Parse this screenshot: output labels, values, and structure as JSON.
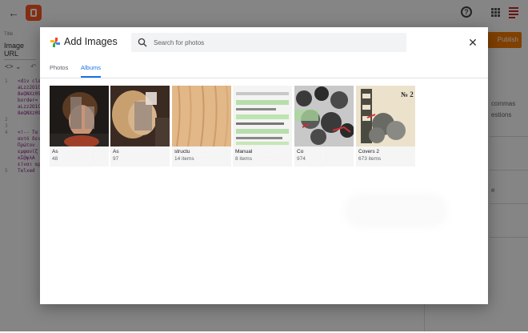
{
  "editor": {
    "title_label": "Title",
    "title_value": "Image URL",
    "publish_label": "Publish",
    "side_text_1": "commas",
    "side_text_2": "estions",
    "side_text_3": "e",
    "code_lines": "<div cla\naLzz2O1C\n8eQNXz09\nborder=\naLzz2O1C\n8eQNXz09\n\n\n<!-- Τα\nαυτό δεν\nΠρώτον\nεμφανίζ\nκΣ@ψλΑ\nείναι αρ\nTelxed",
    "line_numbers": "1 \n\n\n\n\n\n2\n3\n4 \n\n\n\n\n\n5",
    "accent": "#f57c00"
  },
  "dialog": {
    "title": "Add Images",
    "search_placeholder": "Search for photos",
    "close_label": "✕",
    "tabs": [
      {
        "label": "Photos",
        "active": false
      },
      {
        "label": "Albums",
        "active": true
      }
    ],
    "albums": [
      {
        "name": "As",
        "count": "48"
      },
      {
        "name": "As",
        "count": "97"
      },
      {
        "name": "structu",
        "count": "14 items"
      },
      {
        "name": "Manual",
        "count": "8 items"
      },
      {
        "name": "Co",
        "count": "974"
      },
      {
        "name": "Covers 2",
        "count": "673 items"
      }
    ],
    "cover_no_text": "№ 2",
    "link_color": "#1a73e8"
  }
}
